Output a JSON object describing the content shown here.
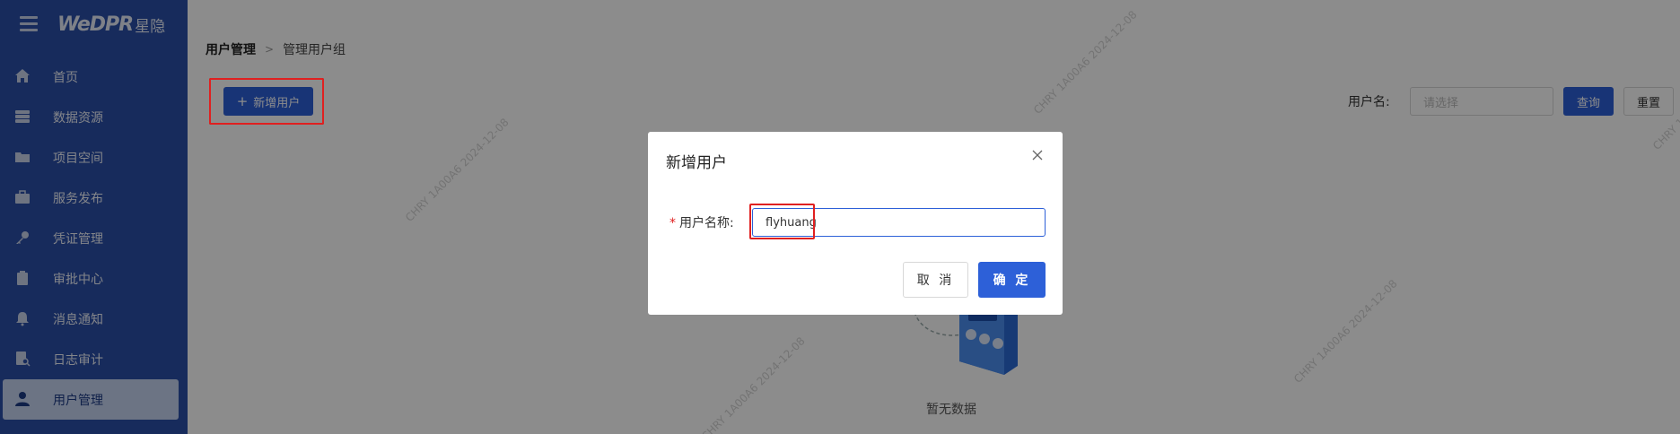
{
  "sidebar": {
    "logo_text": "WeDPR",
    "logo_cn": "星隐",
    "items": [
      {
        "label": "首页",
        "icon": "home-icon"
      },
      {
        "label": "数据资源",
        "icon": "database-icon"
      },
      {
        "label": "项目空间",
        "icon": "folder-icon"
      },
      {
        "label": "服务发布",
        "icon": "briefcase-icon"
      },
      {
        "label": "凭证管理",
        "icon": "key-icon"
      },
      {
        "label": "审批中心",
        "icon": "clipboard-icon"
      },
      {
        "label": "消息通知",
        "icon": "bell-icon"
      },
      {
        "label": "日志审计",
        "icon": "audit-icon"
      },
      {
        "label": "用户管理",
        "icon": "user-icon",
        "active": true
      }
    ]
  },
  "breadcrumb": {
    "level1": "用户管理",
    "separator": ">",
    "level2": "管理用户组"
  },
  "toolbar": {
    "add_user_label": "新增用户",
    "filter_label": "用户名:",
    "filter_placeholder": "请选择",
    "query_label": "查询",
    "reset_label": "重置"
  },
  "empty": {
    "text": "暂无数据"
  },
  "watermark": "CHRY 1A00A6 2024-12-08",
  "modal": {
    "title": "新增用户",
    "field_label": "用户名称:",
    "required_mark": "*",
    "field_value": "flyhuang",
    "cancel_label": "取 消",
    "ok_label": "确 定"
  },
  "colors": {
    "sidebar_bg": "#2b4fa8",
    "primary": "#2d60d8",
    "highlight_box": "#e02020"
  }
}
